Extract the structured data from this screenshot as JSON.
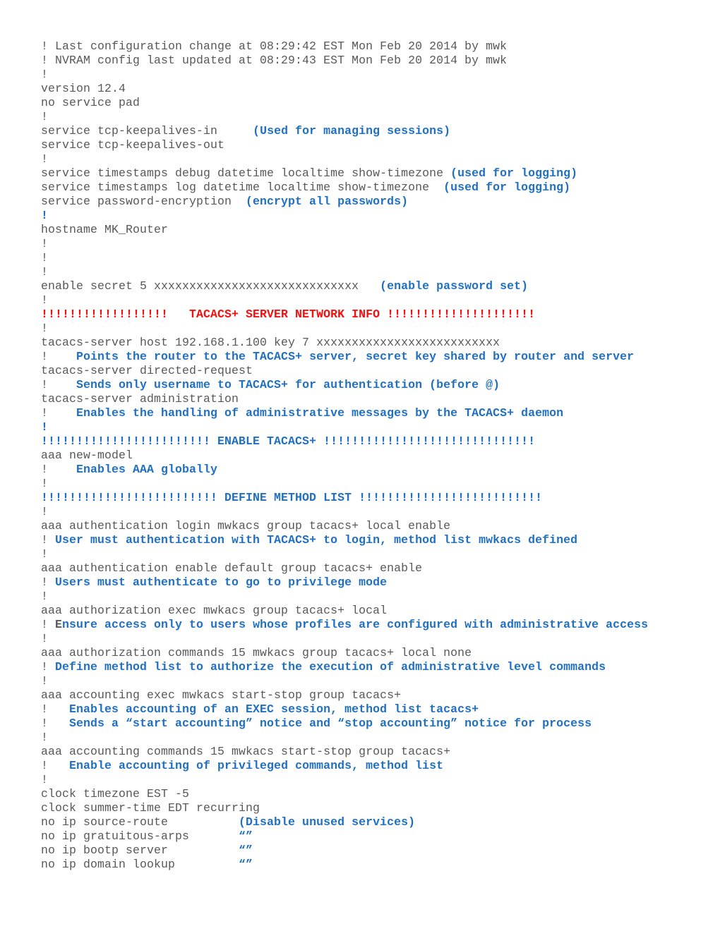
{
  "document": {
    "kind": "cisco-router-running-config",
    "hostname": "MK_Router",
    "colors": {
      "plain_text": "#585858",
      "annotation_blue": "#1F6FC4",
      "banner_red": "#F90E0E",
      "background": "#FFFFFF"
    }
  },
  "lines": [
    {
      "id": "l001",
      "segments": [
        {
          "style": "plain",
          "text": "! Last configuration change at 08:29:42 EST Mon Feb 20 2014 by mwk"
        }
      ]
    },
    {
      "id": "l002",
      "segments": [
        {
          "style": "plain",
          "text": "! NVRAM config last updated at 08:29:43 EST Mon Feb 20 2014 by mwk"
        }
      ]
    },
    {
      "id": "l003",
      "segments": [
        {
          "style": "plain",
          "text": "!"
        }
      ]
    },
    {
      "id": "l004",
      "segments": [
        {
          "style": "plain",
          "text": "version 12.4"
        }
      ]
    },
    {
      "id": "l005",
      "segments": [
        {
          "style": "plain",
          "text": "no service pad"
        }
      ]
    },
    {
      "id": "l006",
      "segments": [
        {
          "style": "plain",
          "text": "!"
        }
      ]
    },
    {
      "id": "l007",
      "segments": [
        {
          "style": "plain",
          "text": "service tcp-keepalives-in     "
        },
        {
          "style": "note",
          "text": "(Used for managing sessions)"
        }
      ]
    },
    {
      "id": "l008",
      "segments": [
        {
          "style": "plain",
          "text": "service tcp-keepalives-out"
        }
      ]
    },
    {
      "id": "l009",
      "segments": [
        {
          "style": "plain",
          "text": "!"
        }
      ]
    },
    {
      "id": "l010",
      "segments": [
        {
          "style": "plain",
          "text": "service timestamps debug datetime localtime show-timezone "
        },
        {
          "style": "note",
          "text": "(used for logging)"
        }
      ]
    },
    {
      "id": "l011",
      "segments": [
        {
          "style": "plain",
          "text": "service timestamps log datetime localtime show-timezone  "
        },
        {
          "style": "note",
          "text": "(used for logging)"
        }
      ]
    },
    {
      "id": "l012",
      "segments": [
        {
          "style": "plain",
          "text": "service password-encryption  "
        },
        {
          "style": "note",
          "text": "(encrypt all passwords)"
        }
      ]
    },
    {
      "id": "l013",
      "segments": [
        {
          "style": "bang-blue",
          "text": "!"
        }
      ]
    },
    {
      "id": "l014",
      "segments": [
        {
          "style": "plain",
          "text": "hostname MK_Router"
        }
      ]
    },
    {
      "id": "l015",
      "segments": [
        {
          "style": "plain",
          "text": "!"
        }
      ]
    },
    {
      "id": "l016",
      "segments": [
        {
          "style": "plain",
          "text": "!"
        }
      ]
    },
    {
      "id": "l017",
      "segments": [
        {
          "style": "plain",
          "text": "!"
        }
      ]
    },
    {
      "id": "l018",
      "segments": [
        {
          "style": "plain",
          "text": "enable secret 5 xxxxxxxxxxxxxxxxxxxxxxxxxxxxx   "
        },
        {
          "style": "note",
          "text": "(enable password set)"
        }
      ]
    },
    {
      "id": "l019",
      "segments": [
        {
          "style": "plain",
          "text": "!"
        }
      ]
    },
    {
      "id": "l020",
      "segments": [
        {
          "style": "banner-red",
          "text": "!!!!!!!!!!!!!!!!!!   TACACS+ SERVER NETWORK INFO !!!!!!!!!!!!!!!!!!!!!"
        }
      ]
    },
    {
      "id": "l021",
      "segments": [
        {
          "style": "plain",
          "text": "!"
        }
      ]
    },
    {
      "id": "l022",
      "segments": [
        {
          "style": "plain",
          "text": "tacacs-server host 192.168.1.100 key 7 xxxxxxxxxxxxxxxxxxxxxxxxxx"
        }
      ]
    },
    {
      "id": "l023",
      "segments": [
        {
          "style": "plain",
          "text": "!    "
        },
        {
          "style": "note",
          "text": "Points the router to the TACACS+ server, secret key shared by router and server"
        }
      ]
    },
    {
      "id": "l024",
      "segments": [
        {
          "style": "plain",
          "text": "tacacs-server directed-request"
        }
      ]
    },
    {
      "id": "l025",
      "segments": [
        {
          "style": "plain",
          "text": "!    "
        },
        {
          "style": "note",
          "text": "Sends only username to TACACS+ for authentication (before @)"
        }
      ]
    },
    {
      "id": "l026",
      "segments": [
        {
          "style": "plain",
          "text": "tacacs-server administration"
        }
      ]
    },
    {
      "id": "l027",
      "segments": [
        {
          "style": "plain",
          "text": "!    "
        },
        {
          "style": "note",
          "text": "Enables the handling of administrative messages by the TACACS+ daemon"
        }
      ]
    },
    {
      "id": "l028",
      "segments": [
        {
          "style": "bang-blue",
          "text": "!"
        }
      ]
    },
    {
      "id": "l029",
      "segments": [
        {
          "style": "banner-blue",
          "text": "!!!!!!!!!!!!!!!!!!!!!!!! ENABLE TACACS+ !!!!!!!!!!!!!!!!!!!!!!!!!!!!!!"
        }
      ]
    },
    {
      "id": "l030",
      "segments": [
        {
          "style": "plain",
          "text": "aaa new-model"
        }
      ]
    },
    {
      "id": "l031",
      "segments": [
        {
          "style": "plain",
          "text": "!    "
        },
        {
          "style": "note",
          "text": "Enables AAA globally"
        }
      ]
    },
    {
      "id": "l032",
      "segments": [
        {
          "style": "plain",
          "text": "!"
        }
      ]
    },
    {
      "id": "l033",
      "segments": [
        {
          "style": "banner-blue",
          "text": "!!!!!!!!!!!!!!!!!!!!!!!!! DEFINE METHOD LIST !!!!!!!!!!!!!!!!!!!!!!!!!!"
        }
      ]
    },
    {
      "id": "l034",
      "segments": [
        {
          "style": "plain",
          "text": "!"
        }
      ]
    },
    {
      "id": "l035",
      "segments": [
        {
          "style": "plain",
          "text": "aaa authentication login mwkacs group tacacs+ local enable"
        }
      ]
    },
    {
      "id": "l036",
      "segments": [
        {
          "style": "plain",
          "text": "! "
        },
        {
          "style": "note",
          "text": "User must authentication with TACACS+ to login, method list mwkacs defined"
        }
      ]
    },
    {
      "id": "l037",
      "segments": [
        {
          "style": "plain",
          "text": "!"
        }
      ]
    },
    {
      "id": "l038",
      "segments": [
        {
          "style": "plain",
          "text": "aaa authentication enable default group tacacs+ enable"
        }
      ]
    },
    {
      "id": "l039",
      "segments": [
        {
          "style": "plain",
          "text": "! "
        },
        {
          "style": "note",
          "text": "Users must authenticate to go to privilege mode"
        }
      ]
    },
    {
      "id": "l040",
      "segments": [
        {
          "style": "plain",
          "text": "!"
        }
      ]
    },
    {
      "id": "l041",
      "segments": [
        {
          "style": "plain",
          "text": "aaa authorization exec mwkacs group tacacs+ local"
        }
      ]
    },
    {
      "id": "l042",
      "segments": [
        {
          "style": "plain",
          "text": "! "
        },
        {
          "style": "note-dark",
          "text": "E"
        },
        {
          "style": "note",
          "text": "nsure access only to users whose profiles are configured with administrative access"
        }
      ]
    },
    {
      "id": "l043",
      "segments": [
        {
          "style": "plain",
          "text": "!"
        }
      ]
    },
    {
      "id": "l044",
      "segments": [
        {
          "style": "plain",
          "text": "aaa authorization commands 15 mwkacs group tacacs+ local none"
        }
      ]
    },
    {
      "id": "l045",
      "segments": [
        {
          "style": "plain",
          "text": "! "
        },
        {
          "style": "note",
          "text": "Define method list to authorize the execution of administrative level commands"
        }
      ]
    },
    {
      "id": "l046",
      "segments": [
        {
          "style": "plain",
          "text": "!"
        }
      ]
    },
    {
      "id": "l047",
      "segments": [
        {
          "style": "plain",
          "text": "aaa accounting exec mwkacs start-stop group tacacs+"
        }
      ]
    },
    {
      "id": "l048",
      "segments": [
        {
          "style": "plain",
          "text": "!   "
        },
        {
          "style": "note",
          "text": "Enables accounting of an EXEC session, method list tacacs+"
        }
      ]
    },
    {
      "id": "l049",
      "segments": [
        {
          "style": "plain",
          "text": "!   "
        },
        {
          "style": "note",
          "text": "Sends a “start accounting” notice and “stop accounting” notice for process"
        }
      ]
    },
    {
      "id": "l050",
      "segments": [
        {
          "style": "plain",
          "text": "!"
        }
      ]
    },
    {
      "id": "l051",
      "segments": [
        {
          "style": "plain",
          "text": "aaa accounting commands 15 mwkacs start-stop group tacacs+"
        }
      ]
    },
    {
      "id": "l052",
      "segments": [
        {
          "style": "plain",
          "text": "!   "
        },
        {
          "style": "note",
          "text": "Enable accounting of privileged commands, method list"
        }
      ]
    },
    {
      "id": "l053",
      "segments": [
        {
          "style": "plain",
          "text": "!"
        }
      ]
    },
    {
      "id": "l054",
      "segments": [
        {
          "style": "plain",
          "text": "clock timezone EST -5"
        }
      ]
    },
    {
      "id": "l055",
      "segments": [
        {
          "style": "plain",
          "text": "clock summer-time EDT recurring"
        }
      ]
    },
    {
      "id": "l056",
      "segments": [
        {
          "style": "plain",
          "text": "no ip source-route          "
        },
        {
          "style": "note",
          "text": "(Disable unused services)"
        }
      ]
    },
    {
      "id": "l057",
      "segments": [
        {
          "style": "plain",
          "text": "no ip gratuitous-arps       "
        },
        {
          "style": "note",
          "text": "“”"
        }
      ]
    },
    {
      "id": "l058",
      "segments": [
        {
          "style": "plain",
          "text": "no ip bootp server          "
        },
        {
          "style": "note",
          "text": "“”"
        }
      ]
    },
    {
      "id": "l059",
      "segments": [
        {
          "style": "plain",
          "text": "no ip domain lookup         "
        },
        {
          "style": "note",
          "text": "“”"
        }
      ]
    }
  ]
}
